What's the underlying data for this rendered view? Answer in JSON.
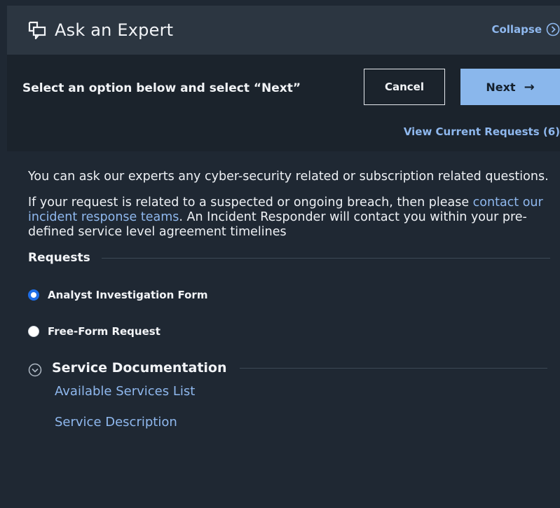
{
  "header": {
    "title": "Ask an Expert",
    "icon": "chat-windows-icon",
    "collapse_label": "Collapse"
  },
  "toolbar": {
    "instruction": "Select an option below and select “Next”",
    "cancel_label": "Cancel",
    "next_label": "Next",
    "next_arrow": "→",
    "view_requests_label": "View Current Requests (6)"
  },
  "intro": {
    "paragraph1": "You can ask our experts any cyber-security related or subscription related questions.",
    "paragraph2_before": "If your request is related to a suspected or ongoing breach, then please ",
    "paragraph2_link": "contact our incident response teams",
    "paragraph2_after": ". An Incident Responder will contact you within your pre-defined service level agreement timelines"
  },
  "requests": {
    "heading": "Requests",
    "options": [
      {
        "label": "Analyst Investigation Form",
        "selected": true
      },
      {
        "label": "Free-Form Request",
        "selected": false
      }
    ]
  },
  "documentation": {
    "heading": "Service Documentation",
    "links": [
      {
        "label": "Available Services List"
      },
      {
        "label": "Service Description"
      }
    ]
  },
  "colors": {
    "background": "#1f2833",
    "header_bg": "#2c3641",
    "toolbar_bg": "#1b232c",
    "accent": "#8fb8ee",
    "primary_button": "#8ab7ec",
    "radio_selected": "#1e6de6"
  }
}
